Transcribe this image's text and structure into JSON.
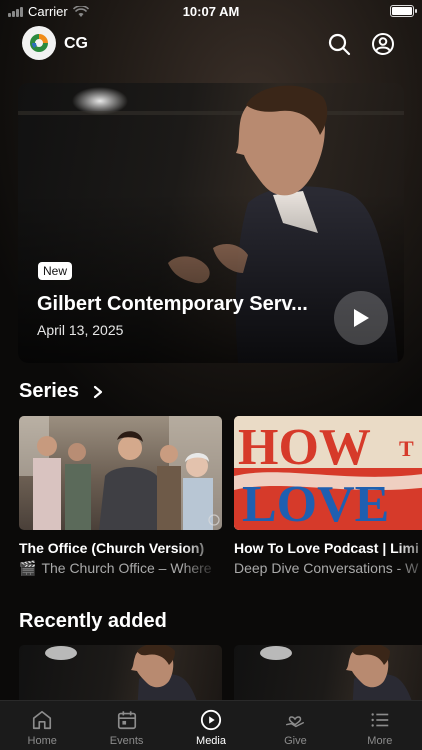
{
  "status": {
    "carrier": "Carrier",
    "time": "10:07 AM"
  },
  "header": {
    "brand": "CG",
    "icons": [
      "search-icon",
      "account-icon"
    ]
  },
  "hero": {
    "badge": "New",
    "title": "Gilbert Contemporary Serv...",
    "date": "April 13, 2025"
  },
  "series": {
    "heading": "Series",
    "items": [
      {
        "title": "The Office (Church Version)",
        "icon": "🎬",
        "subtitle": "The Church Office – Where"
      },
      {
        "title": "How To Love Podcast | Limi",
        "icon": "",
        "subtitle": "Deep Dive Conversations - W"
      }
    ],
    "artwork_text": {
      "line1": "HOW",
      "line1b": "T",
      "line2": "LOVE"
    }
  },
  "recent": {
    "heading": "Recently added"
  },
  "tabs": [
    {
      "label": "Home",
      "icon": "home-icon",
      "active": false
    },
    {
      "label": "Events",
      "icon": "calendar-icon",
      "active": false
    },
    {
      "label": "Media",
      "icon": "play-circle-icon",
      "active": true
    },
    {
      "label": "Give",
      "icon": "give-heart-icon",
      "active": false
    },
    {
      "label": "More",
      "icon": "menu-list-icon",
      "active": false
    }
  ],
  "colors": {
    "background": "#0b0a09",
    "tab_bar": "#1b1b1b",
    "love_red": "#d63a2a",
    "love_blue": "#1f5fb0"
  }
}
